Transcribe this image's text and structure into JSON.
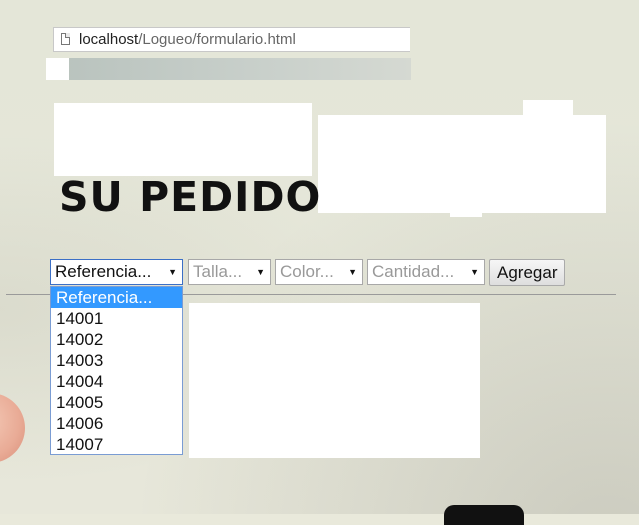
{
  "browser": {
    "url_host": "localhost",
    "url_path": "/Logueo/formulario.html"
  },
  "page": {
    "title": "SU PEDIDO"
  },
  "form": {
    "referencia": {
      "selected": "Referencia...",
      "options": [
        "Referencia...",
        "14001",
        "14002",
        "14003",
        "14004",
        "14005",
        "14006",
        "14007"
      ]
    },
    "talla": {
      "placeholder": "Talla..."
    },
    "color": {
      "placeholder": "Color..."
    },
    "cantidad": {
      "placeholder": "Cantidad..."
    },
    "add_button": "Agregar"
  },
  "icons": {
    "page_icon": "document-icon",
    "select_arrow": "▼"
  }
}
